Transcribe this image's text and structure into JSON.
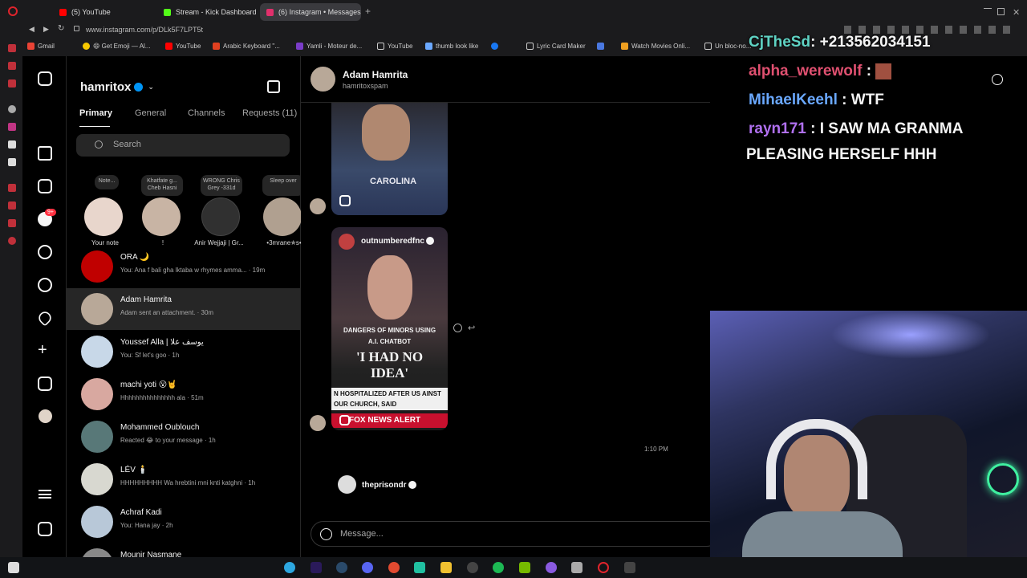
{
  "browser": {
    "tabs": [
      {
        "label": "(5) YouTube",
        "color": "#ff0000"
      },
      {
        "label": "Stream - Kick Dashboard",
        "color": "#53fc18"
      },
      {
        "label": "(6) Instagram • Messages",
        "color": "#e1306c"
      }
    ],
    "new_tab": "+",
    "url": "www.instagram.com/p/DLk5F7LPT5t",
    "bookmarks": [
      "Gmail",
      "😄 Get Emoji — Al...",
      "YouTube",
      "Arabic Keyboard \"...",
      "Yamli - Moteur de...",
      "YouTube",
      "thumb look like",
      "Lyric Card Maker",
      "Watch Movies Onli...",
      "Un bloc-no..."
    ]
  },
  "sidebar": {
    "username": "hamritox",
    "tabs": [
      "Primary",
      "General",
      "Channels",
      "Requests (11)"
    ],
    "search_placeholder": "Search",
    "notifications_badge": "9+",
    "notes": [
      {
        "bubble": "Note...",
        "caption": "Your note",
        "color": "#e8d6cc"
      },
      {
        "bubble": "Khatfate g... Cheb Hasni",
        "caption": "!",
        "color": "#c8b4a4"
      },
      {
        "bubble": "WRONG Chris Grey -331d",
        "caption": "Anir Wejjaji | Gr...",
        "color": "#303030"
      },
      {
        "bubble": "Sleep over",
        "caption": "•3mrane✯s•",
        "color": "#b0a090"
      }
    ],
    "conversations": [
      {
        "name": "ORA 🌙",
        "preview": "You: Ana f bali gha lktaba w rhymes amma... · 19m",
        "color": "#c00000"
      },
      {
        "name": "Adam Hamrita",
        "preview": "Adam sent an attachment. · 30m",
        "color": "#b8a898"
      },
      {
        "name": "Youssef Alla | يوسف علا",
        "preview": "You: Sf let's goo · 1h",
        "color": "#c8d8e8"
      },
      {
        "name": "machi yoti 😮🤘",
        "preview": "Hhhhhhhhhhhhhhh ala · 51m",
        "color": "#d8a8a0"
      },
      {
        "name": "Mohammed Oublouch",
        "preview": "Reacted 😂 to your message · 1h",
        "color": "#587878"
      },
      {
        "name": "LÉV 🕯️",
        "preview": "HHHHHHHHH Wa hrebtini mni knti katghni · 1h",
        "color": "#d8d8d0"
      },
      {
        "name": "Achraf Kadi",
        "preview": "You: Hana jay · 2h",
        "color": "#b8c8d8"
      },
      {
        "name": "Mounir Nasmane",
        "preview": "",
        "color": "#888"
      }
    ]
  },
  "conversation": {
    "name": "Adam Hamrita",
    "handle": "hamritoxspam",
    "post1_text": "CAROLINA",
    "post2_author": "outnumberedfnc",
    "post2_caption1": "DANGERS OF MINORS USING A.I. CHATBOT",
    "post2_caption2": "'I HAD NO IDEA'",
    "post2_ticker": "N HOSPITALIZED AFTER US AINST OUR CHURCH, SAID",
    "post2_network": "FOX NEWS ALERT",
    "timestamp": "1:10 PM",
    "post3_author": "theprisondr",
    "message_placeholder": "Message..."
  },
  "stream_chat": [
    {
      "user": "CjTheSd",
      "msg": ": +213562034151",
      "color": "#5fd3c4"
    },
    {
      "user": "alpha_werewolf",
      "msg": " : ",
      "color": "#e05070"
    },
    {
      "user": "MihaelKeehl",
      "msg": " : WTF",
      "color": "#6aa8ff"
    },
    {
      "user": "rayn171",
      "msg": " : I SAW MA GRANMA",
      "color": "#b070f0"
    },
    {
      "user": "",
      "msg": "PLEASING HERSELF HHH",
      "color": "#ffffff"
    }
  ]
}
